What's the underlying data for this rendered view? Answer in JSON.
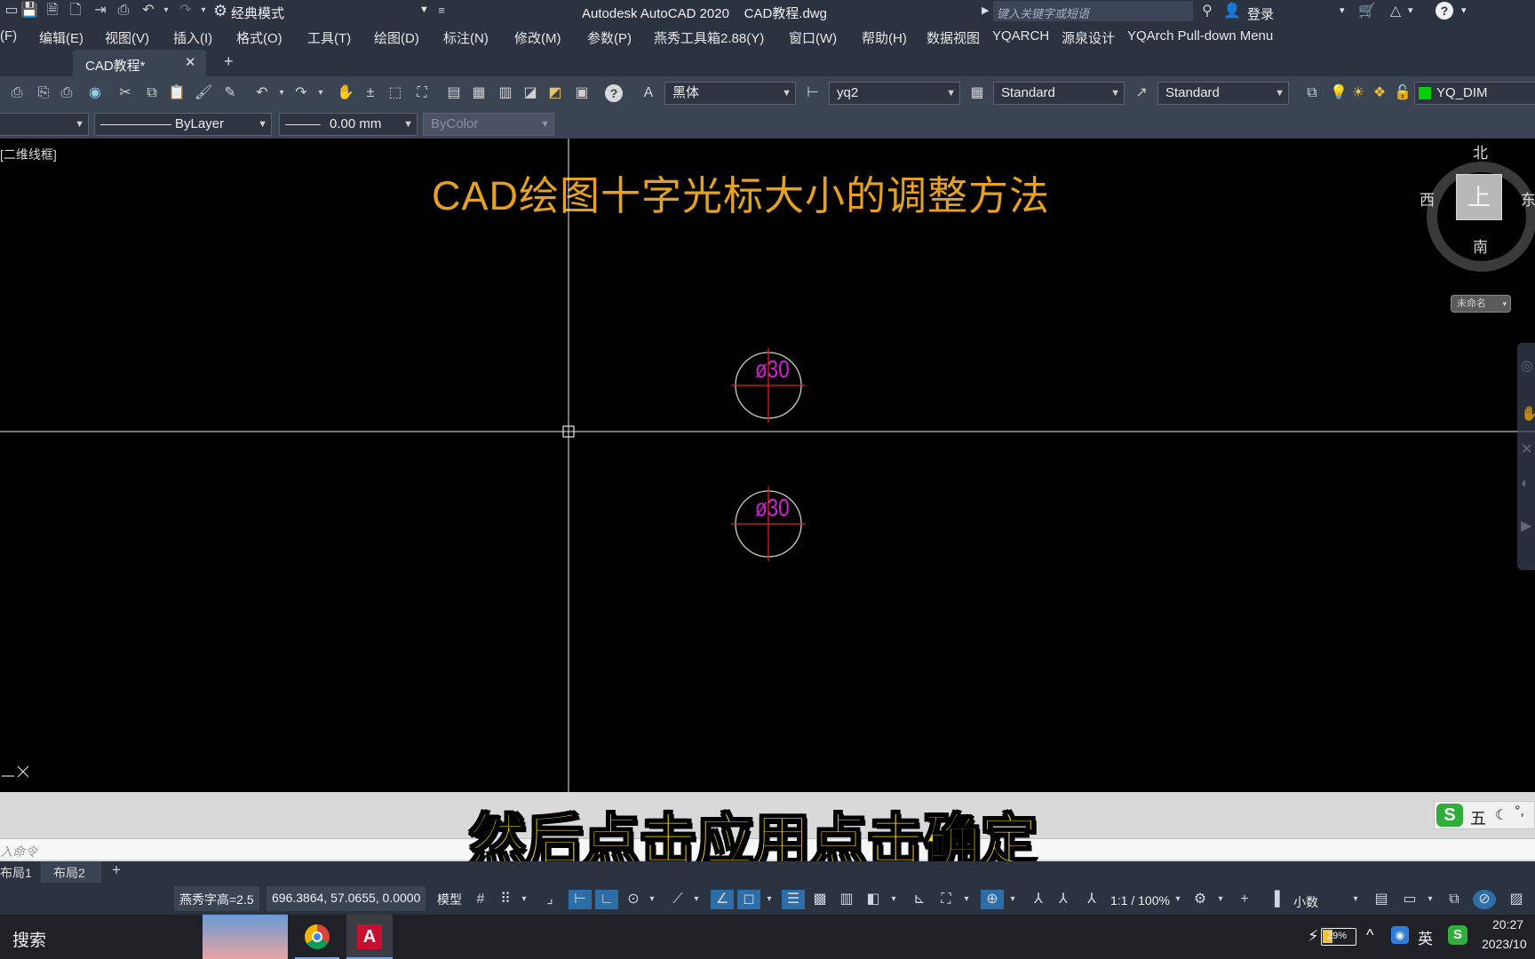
{
  "titlebar": {
    "workspace": "经典模式",
    "title": "Autodesk AutoCAD 2020    CAD教程.dwg",
    "search_placeholder": "键入关键字或短语",
    "login": "登录"
  },
  "menu": [
    "(F)",
    "编辑(E)",
    "视图(V)",
    "插入(I)",
    "格式(O)",
    "工具(T)",
    "绘图(D)",
    "标注(N)",
    "修改(M)",
    "参数(P)",
    "燕秀工具箱2.88(Y)",
    "窗口(W)",
    "帮助(H)",
    "数据视图",
    "YQARCH",
    "源泉设计",
    "YQArch Pull-down Menu"
  ],
  "tabs": {
    "active": "CAD教程*",
    "close": "✕",
    "add": "+"
  },
  "toolbar1": {
    "font": "黑体",
    "dim_style": "yq2",
    "table_style": "Standard",
    "multileader_style": "Standard",
    "layer": "YQ_DIM"
  },
  "toolbar2": {
    "linetype": "ByLayer",
    "lineweight": "0.00 mm",
    "color": "ByColor"
  },
  "canvas": {
    "viewport_label": "[二维线框]",
    "heading": "CAD绘图十字光标大小的调整方法",
    "dim_text_1": "ø30",
    "dim_text_2": "ø30",
    "viewcube": {
      "north": "北",
      "south": "南",
      "west": "西",
      "east": "东",
      "face": "上",
      "ucs": "未命名"
    }
  },
  "command": {
    "placeholder": "入命令",
    "subtitle": "然后点击应用点击确定"
  },
  "ime": {
    "mode": "五"
  },
  "layouts": [
    "布局1",
    "布局2"
  ],
  "statusbar": {
    "text_height": "燕秀字高=2.5",
    "coords": "696.3864, 57.0655, 0.0000",
    "model": "模型",
    "scale": "1:1 / 100%",
    "units": "小数"
  },
  "taskbar": {
    "search": "搜索",
    "battery": "29%",
    "ime": "英",
    "time": "20:27",
    "date": "2023/10"
  },
  "colors": {
    "heading": "#e6a11f",
    "subtitle": "#ffe11a",
    "dim_text": "#d11fd1",
    "center_line": "#e02020",
    "circle": "#c8d8b0"
  }
}
